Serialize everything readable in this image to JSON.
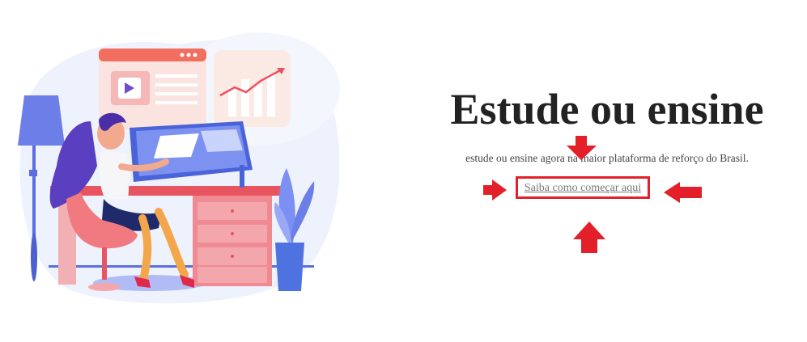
{
  "hero": {
    "title": "Estude ou ensine",
    "subtitle": "estude ou ensine agora na maior plataforma de reforço do Brasil.",
    "cta_label": "Saiba como começar aqui"
  },
  "colors": {
    "annotation": "#e3202a",
    "title": "#222222",
    "accent_blue": "#5b6ee1",
    "accent_pink": "#f08a8f"
  },
  "icons": [
    "play-icon",
    "trend-chart-icon",
    "lamp-icon",
    "plant-icon",
    "arrow-down-icon",
    "arrow-up-icon",
    "arrow-right-icon",
    "arrow-left-icon"
  ]
}
